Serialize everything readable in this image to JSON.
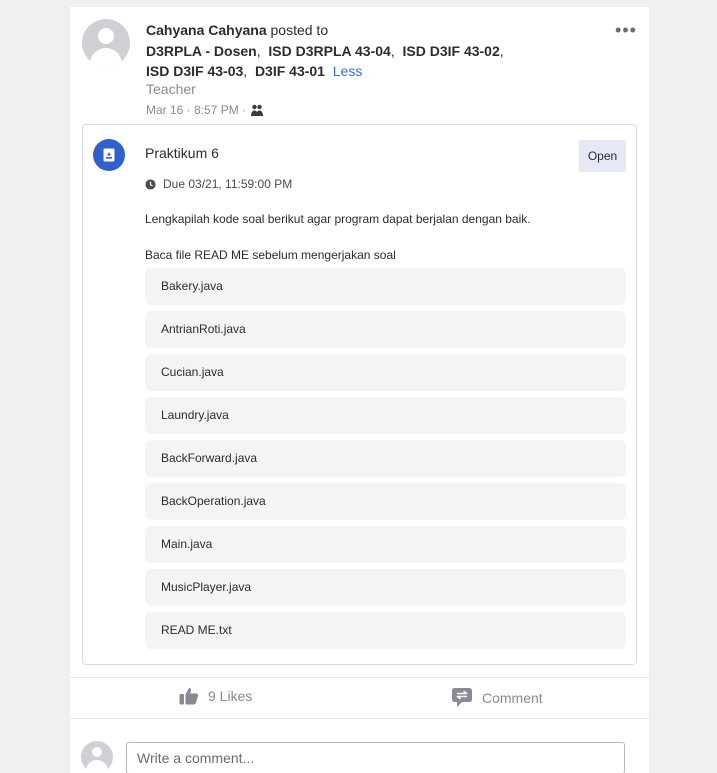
{
  "post": {
    "author": "Cahyana Cahyana",
    "posted_to_text": "posted to",
    "groups": [
      "D3RPLA - Dosen",
      "ISD D3RPLA 43-04",
      "ISD D3IF 43-02",
      "ISD D3IF 43-03",
      "D3IF 43-01"
    ],
    "less_label": "Less",
    "role": "Teacher",
    "date": "Mar 16 · 8:57 PM ·",
    "more_icon": "more-horizontal-icon"
  },
  "assignment": {
    "title": "Praktikum 6",
    "open_label": "Open",
    "due": "Due 03/21, 11:59:00 PM",
    "description_1": "Lengkapilah kode soal berikut agar program dapat berjalan dengan baik.",
    "description_2": "Baca file READ ME sebelum mengerjakan soal",
    "files": [
      "Bakery.java",
      "AntrianRoti.java",
      "Cucian.java",
      "Laundry.java",
      "BackForward.java",
      "BackOperation.java",
      "Main.java",
      "MusicPlayer.java",
      "READ ME.txt"
    ]
  },
  "actions": {
    "likes_label": "9 Likes",
    "comment_label": "Comment"
  },
  "comment_box": {
    "placeholder": "Write a comment..."
  },
  "colors": {
    "accent": "#3060d0",
    "link": "#3d6dd6",
    "open_button_bg": "#e6e8f6",
    "file_bg": "#f4f4f5"
  }
}
